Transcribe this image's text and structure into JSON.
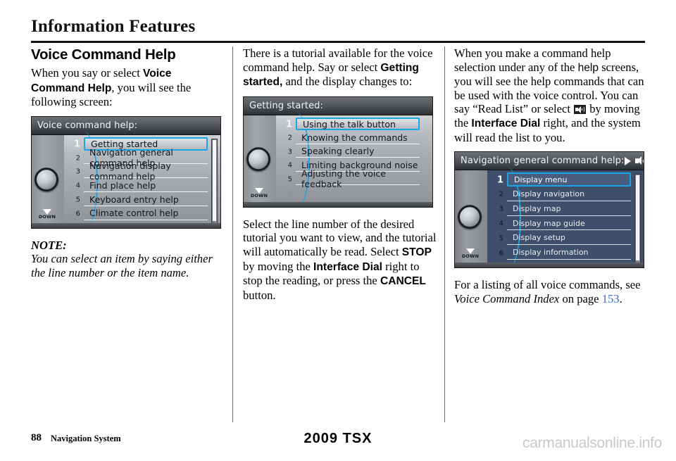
{
  "page": {
    "title": "Information Features",
    "footer_page_number": "88",
    "footer_section": "Navigation System",
    "footer_model": "2009  TSX",
    "watermark": "carmanualsonline.info"
  },
  "left_column": {
    "heading": "Voice Command Help",
    "intro_1": "When you say or select ",
    "intro_bold": "Voice Command Help",
    "intro_2": ", you will see the following screen:",
    "note_head": "NOTE:",
    "note_body": "You can select an item by saying either the line number or the item name."
  },
  "middle_column": {
    "para_1a": "There is a tutorial available for the voice command help. Say or select ",
    "para_1_bold": "Getting started,",
    "para_1b": " and the display changes to:",
    "para_2a": "Select the line number of the desired tutorial you want to view, and the tutorial will automatically be read. Select ",
    "para_2_bold_1": "STOP",
    "para_2b": " by moving the ",
    "para_2_bold_2": "Interface Dial",
    "para_2c": " right to stop the reading, or press the ",
    "para_2_bold_3": "CANCEL",
    "para_2d": " button."
  },
  "right_column": {
    "para_1a": "When you make a command help selection under any of the ",
    "para_1_sans": "help",
    "para_1b": " screens, you will see the help commands that can be used with the voice control. You can say “Read List” or select ",
    "para_1_icon": "speaker-icon",
    "para_1c": " by moving the ",
    "para_1_bold": "Interface Dial",
    "para_1d": " right, and the system will read the list to you.",
    "para_2a": "For a listing of all voice commands, see ",
    "para_2_italic": "Voice Command Index",
    "para_2b": " on page ",
    "para_2_pageref": "153",
    "para_2c": "."
  },
  "screens": [
    {
      "id": "voice-command-help",
      "header": "Voice command help:",
      "theme": "silver",
      "has_scrollbar": true,
      "header_icons": [],
      "dial_label": "DOWN",
      "items": [
        {
          "number": "1",
          "label": "Getting started",
          "selected": true
        },
        {
          "number": "2",
          "label": "Navigation general command help",
          "selected": false
        },
        {
          "number": "3",
          "label": "Navigation display command help",
          "selected": false
        },
        {
          "number": "4",
          "label": "Find place help",
          "selected": false
        },
        {
          "number": "5",
          "label": "Keyboard entry help",
          "selected": false
        },
        {
          "number": "6",
          "label": "Climate control help",
          "selected": false
        }
      ]
    },
    {
      "id": "getting-started",
      "header": "Getting started:",
      "theme": "silver",
      "has_scrollbar": false,
      "header_icons": [],
      "dial_label": "DOWN",
      "items": [
        {
          "number": "1",
          "label": "Using the talk button",
          "selected": true
        },
        {
          "number": "2",
          "label": "Knowing the commands",
          "selected": false
        },
        {
          "number": "3",
          "label": "Speaking clearly",
          "selected": false
        },
        {
          "number": "4",
          "label": "Limiting background noise",
          "selected": false
        },
        {
          "number": "5",
          "label": "Adjusting the voice feedback",
          "selected": false
        },
        {
          "number": "6",
          "label": "",
          "selected": false
        }
      ]
    },
    {
      "id": "navigation-general-command-help",
      "header": "Navigation general command help:",
      "theme": "blue",
      "has_scrollbar": true,
      "header_icons": [
        "play-icon",
        "speaker-icon"
      ],
      "dial_label": "DOWN",
      "items": [
        {
          "number": "1",
          "label": "Display menu",
          "selected": true
        },
        {
          "number": "2",
          "label": "Display navigation",
          "selected": false
        },
        {
          "number": "3",
          "label": "Display map",
          "selected": false
        },
        {
          "number": "4",
          "label": "Display map guide",
          "selected": false
        },
        {
          "number": "5",
          "label": "Display setup",
          "selected": false
        },
        {
          "number": "6",
          "label": "Display information",
          "selected": false
        }
      ]
    }
  ]
}
